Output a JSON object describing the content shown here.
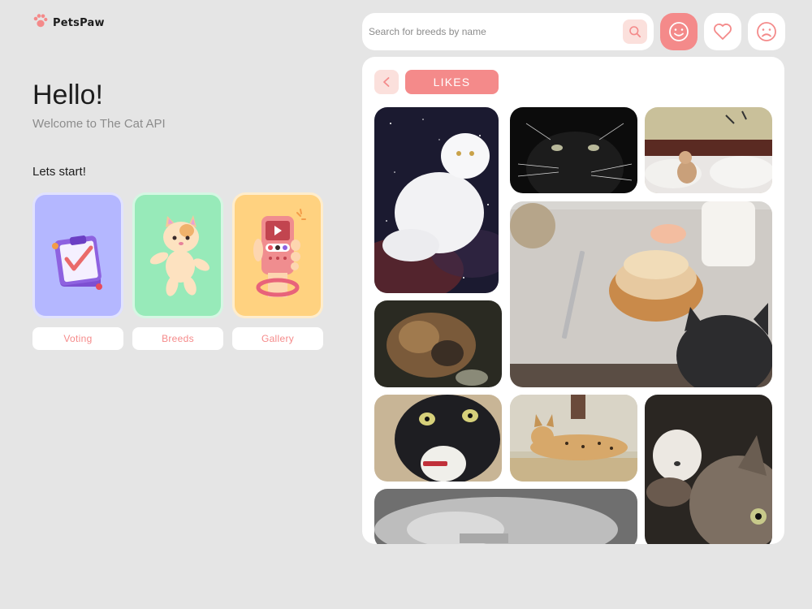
{
  "logo": {
    "text": "PetsPaw",
    "icon": "paw-icon",
    "accent": "#f48a8a"
  },
  "greeting": {
    "title": "Hello!",
    "subtitle": "Welcome to The Cat API",
    "prompt": "Lets start!"
  },
  "cards": [
    {
      "label": "Voting",
      "icon": "clipboard-illustration"
    },
    {
      "label": "Breeds",
      "icon": "cat-illustration"
    },
    {
      "label": "Gallery",
      "icon": "phone-illustration"
    }
  ],
  "search": {
    "placeholder": "Search for breeds by name",
    "value": "",
    "icon": "search-icon"
  },
  "toolbar": {
    "likes_icon": "smile-icon",
    "favourites_icon": "heart-icon",
    "dislikes_icon": "sad-icon"
  },
  "panel": {
    "back_icon": "chevron-left-icon",
    "section": "LIKES"
  },
  "gallery": {
    "photos": [
      "cat-in-space",
      "black-cat-closeup",
      "kitten-on-bed",
      "kitten-with-toast",
      "tortoiseshell-cat",
      "tuxedo-cat",
      "serval-cat",
      "kittens-grey-tabby",
      "cat-in-bed"
    ]
  },
  "colors": {
    "background": "#e5e5e5",
    "accent": "#f48a8a",
    "accent_light": "#fbe0dc",
    "voting": "#b4b7ff",
    "breeds": "#97eab9",
    "gallery": "#ffd280"
  }
}
